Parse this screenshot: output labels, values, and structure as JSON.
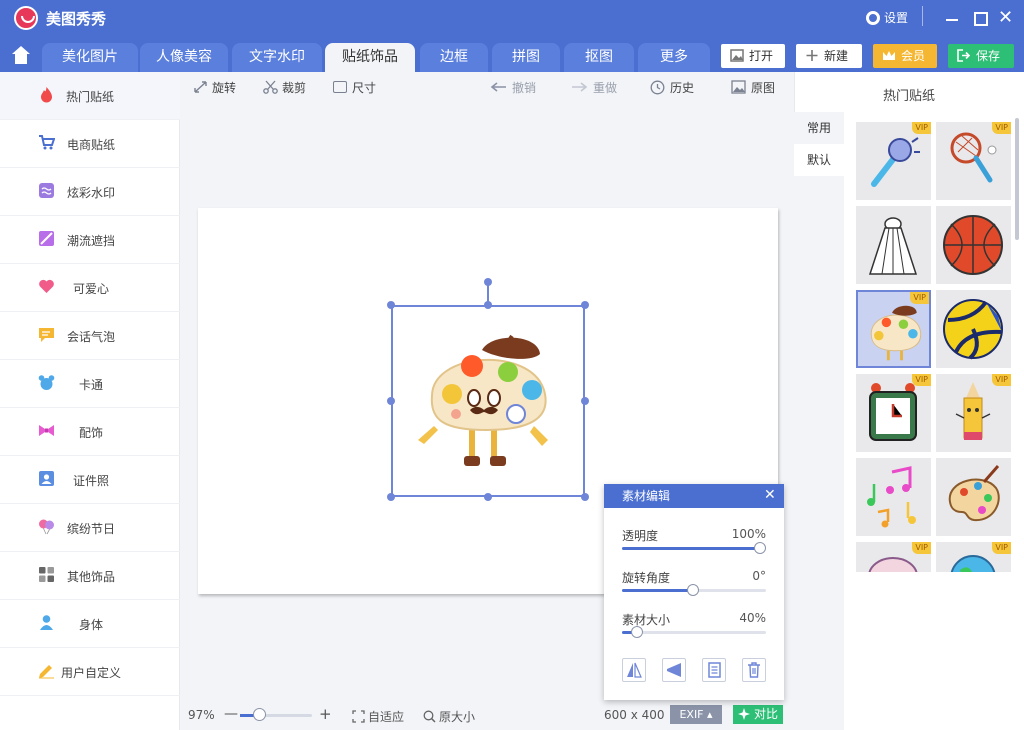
{
  "app": {
    "title": "美图秀秀",
    "settings_label": "设置"
  },
  "tabs": [
    "美化图片",
    "人像美容",
    "文字水印",
    "贴纸饰品",
    "边框",
    "拼图",
    "抠图",
    "更多"
  ],
  "top_buttons": {
    "open": "打开",
    "new": "新建",
    "vip": "会员",
    "save": "保存"
  },
  "sidebar": [
    {
      "label": "热门贴纸",
      "icon": "flame-icon",
      "color": "#f04a4a"
    },
    {
      "label": "电商贴纸",
      "icon": "cart-icon",
      "color": "#4a6fd1"
    },
    {
      "label": "炫彩水印",
      "icon": "watermark-icon",
      "color": "#9c7be0"
    },
    {
      "label": "潮流遮挡",
      "icon": "mask-icon",
      "color": "#b86ee8"
    },
    {
      "label": "可爱心",
      "icon": "heart-icon",
      "color": "#f05b8a"
    },
    {
      "label": "会话气泡",
      "icon": "speech-bubble-icon",
      "color": "#f5b731"
    },
    {
      "label": "卡通",
      "icon": "bear-icon",
      "color": "#4fa8e8"
    },
    {
      "label": "配饰",
      "icon": "bow-icon",
      "color": "#e85ad0"
    },
    {
      "label": "证件照",
      "icon": "id-photo-icon",
      "color": "#5b8ee0"
    },
    {
      "label": "缤纷节日",
      "icon": "balloon-icon",
      "color": "#ee6aa0"
    },
    {
      "label": "其他饰品",
      "icon": "grid-icon",
      "color": "#666666"
    },
    {
      "label": "身体",
      "icon": "person-icon",
      "color": "#4fa8e8"
    },
    {
      "label": "用户自定义",
      "icon": "pencil-icon",
      "color": "#f5b731"
    }
  ],
  "toolbar": {
    "rotate": "旋转",
    "crop": "裁剪",
    "size": "尺寸",
    "undo": "撤销",
    "redo": "重做",
    "history": "历史",
    "original": "原图"
  },
  "statusbar": {
    "zoom": "97%",
    "zoom_level": 0.27,
    "fit": "自适应",
    "actual_size": "原大小",
    "image_size": "600 x 400",
    "exif": "EXIF",
    "compare": "对比"
  },
  "panel": {
    "title": "素材编辑",
    "opacity_label": "透明度",
    "opacity_value": "100%",
    "opacity_level": 1.0,
    "rotation_label": "旋转角度",
    "rotation_value": "0°",
    "rotation_level": 0.5,
    "size_label": "素材大小",
    "size_value": "40%",
    "size_level": 0.1
  },
  "right_panel": {
    "title": "热门贴纸",
    "tabs": [
      "常用",
      "默认"
    ],
    "selected_tab": "默认",
    "stickers": [
      {
        "name": "microphone-sticker",
        "vip": "VIP"
      },
      {
        "name": "badminton-racket-sticker",
        "vip": "VIP"
      },
      {
        "name": "shuttlecock-sticker",
        "vip": ""
      },
      {
        "name": "basketball-sticker",
        "vip": ""
      },
      {
        "name": "mushroom-character-sticker",
        "vip": "VIP"
      },
      {
        "name": "volleyball-sticker",
        "vip": ""
      },
      {
        "name": "alarm-clock-sticker",
        "vip": "VIP"
      },
      {
        "name": "pencil-character-sticker",
        "vip": "VIP"
      },
      {
        "name": "music-notes-sticker",
        "vip": ""
      },
      {
        "name": "palette-sticker",
        "vip": ""
      },
      {
        "name": "cartoon-sticker",
        "vip": "VIP"
      },
      {
        "name": "globe-sticker",
        "vip": "VIP"
      }
    ]
  },
  "colors": {
    "brand": "#4a6fd1",
    "vip": "#f5b731",
    "save": "#2ebf76"
  }
}
